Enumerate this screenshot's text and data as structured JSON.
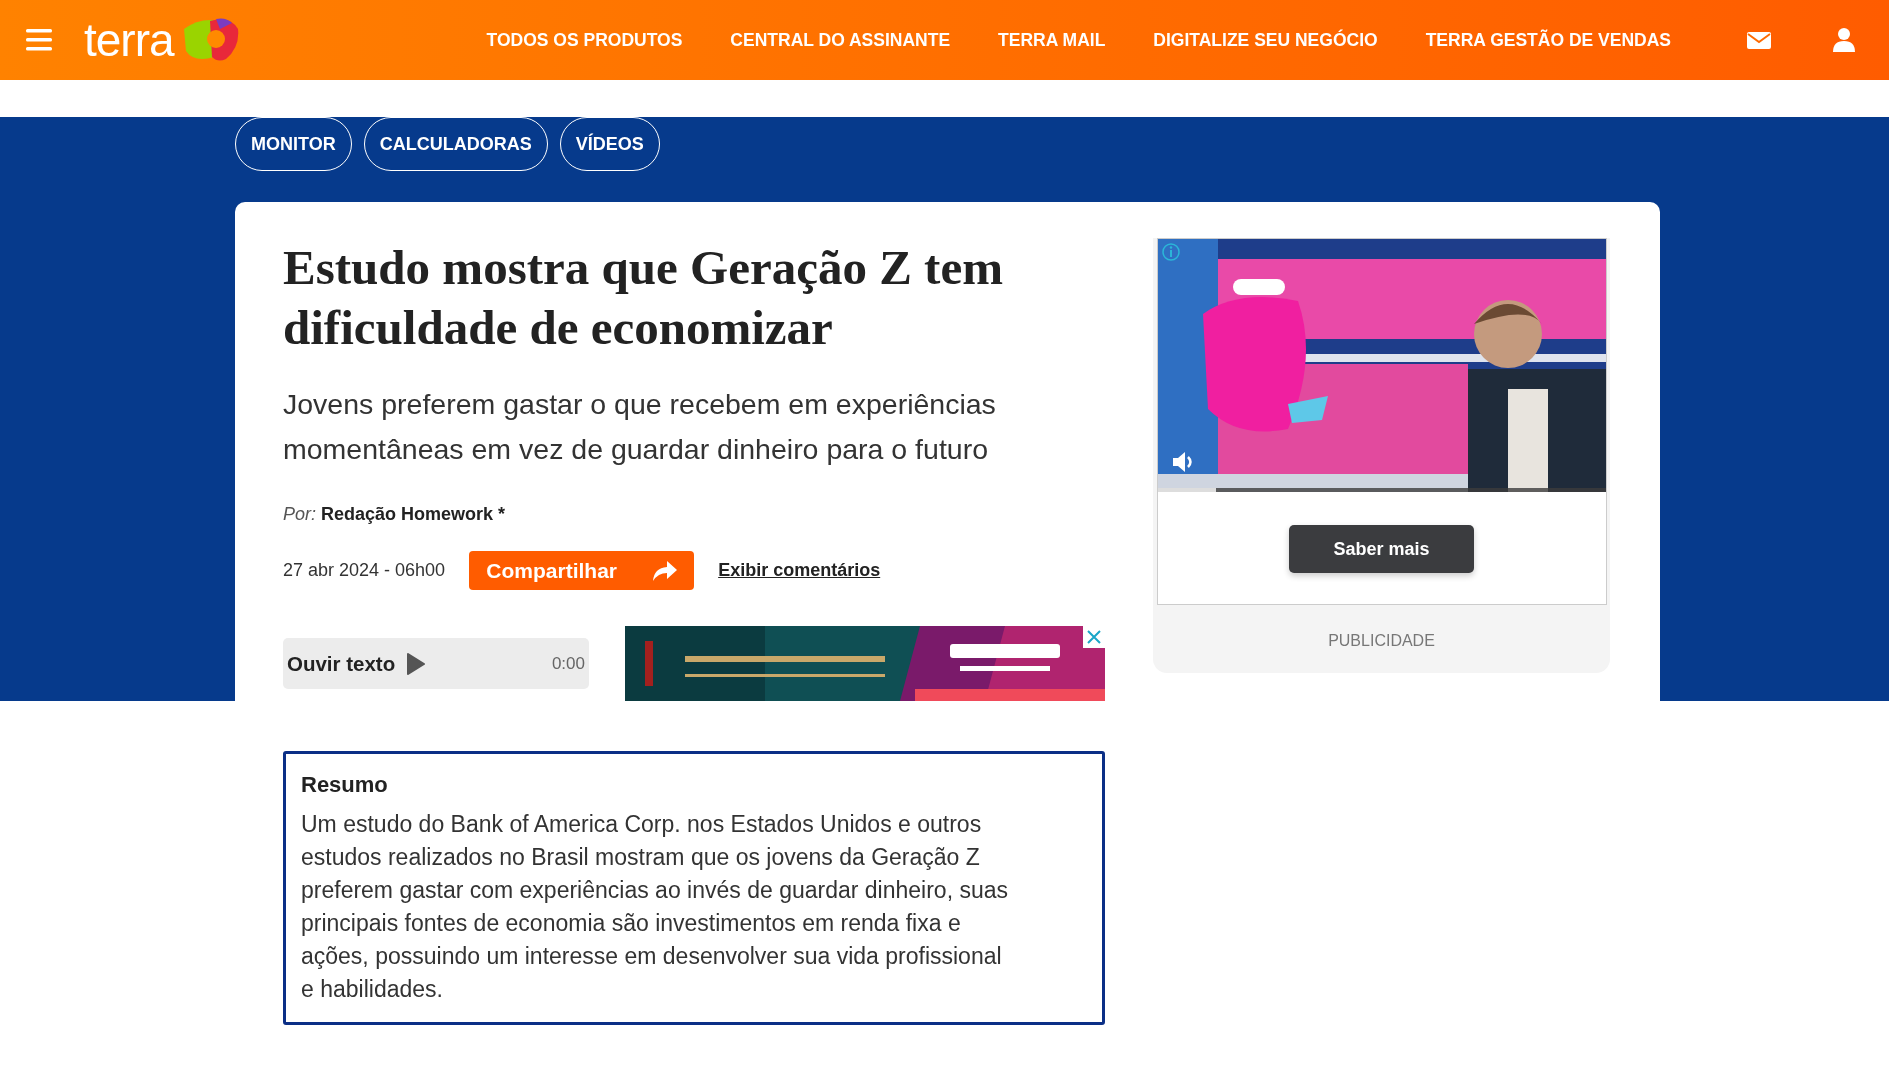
{
  "header": {
    "logo": "terra",
    "nav": [
      "TODOS OS PRODUTOS",
      "CENTRAL DO ASSINANTE",
      "TERRA MAIL",
      "DIGITALIZE SEU NEGÓCIO",
      "TERRA GESTÃO DE VENDAS"
    ]
  },
  "category_rows": [
    [
      "MONITOR",
      "CALCULADORAS",
      "VÍDEOS"
    ]
  ],
  "article": {
    "title": "Estudo mostra que Geração Z tem dificuldade de economizar",
    "subtitle": "Jovens preferem gastar o que recebem em experiências momentâneas em vez de guardar dinheiro para o futuro",
    "byline_prefix": "Por:",
    "author": "Redação Homework *",
    "date": "27 abr 2024 - 06h00",
    "share_button": "Compartilhar",
    "comments_link": "Exibir comentários",
    "audio": {
      "label": "Ouvir texto",
      "time": "0:00"
    },
    "summary": {
      "title": "Resumo",
      "text": "Um estudo do Bank of America Corp. nos Estados Unidos e outros estudos realizados no Brasil mostram que os jovens da Geração Z preferem gastar com experiências ao invés de guardar dinheiro, suas principais fontes de economia são investimentos em renda fixa e ações, possuindo um interesse em desenvolver sua vida profissional e habilidades."
    }
  },
  "side_ad": {
    "video": {
      "kind": "picture",
      "level": 0.13
    },
    "button": "Saber mais",
    "label": "PUBLICIDADE"
  }
}
